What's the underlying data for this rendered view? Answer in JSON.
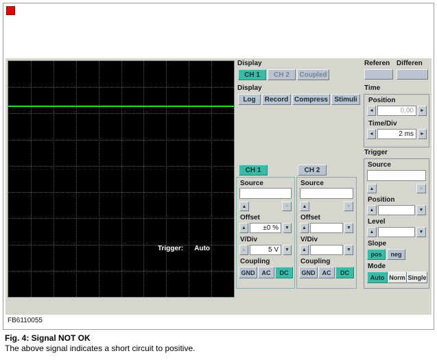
{
  "icons": {
    "up": "▲",
    "down": "▼",
    "left": "◄",
    "right": "►"
  },
  "scope": {
    "trigger_label": "Trigger:",
    "trigger_mode": "Auto",
    "grid": {
      "cols": 10,
      "rows": 9
    },
    "signal": {
      "color": "#1fe11f",
      "y_percent": 18.8
    }
  },
  "display_channels": {
    "label": "Display",
    "buttons": [
      "CH 1",
      "CH 2",
      "Coupled"
    ]
  },
  "display_modes": {
    "label": "Display",
    "buttons": [
      "Log",
      "Record",
      "Compress",
      "Stimuli"
    ]
  },
  "reference": {
    "label": "Referen"
  },
  "differential": {
    "label": "Differen"
  },
  "time": {
    "label": "Time",
    "position_label": "Position",
    "position_value": "0,00",
    "timediv_label": "Time/Div",
    "timediv_value": "2 ms"
  },
  "trigger": {
    "label": "Trigger",
    "source_label": "Source",
    "source_value": "",
    "position_label": "Position",
    "position_value": "",
    "level_label": "Level",
    "level_value": "",
    "slope_label": "Slope",
    "slope_pos": "pos",
    "slope_neg": "neg",
    "mode_label": "Mode",
    "mode_auto": "Auto",
    "mode_norm": "Norm",
    "mode_single": "Single"
  },
  "ch1": {
    "tab": "CH 1",
    "source_label": "Source",
    "source_value": "",
    "offset_label": "Offset",
    "offset_value": "±0 %",
    "vdiv_label": "V/Div",
    "vdiv_value": "5 V",
    "coupling_label": "Coupling",
    "gnd": "GND",
    "ac": "AC",
    "dc": "DC"
  },
  "ch2": {
    "tab": "CH 2",
    "source_label": "Source",
    "source_value": "",
    "offset_label": "Offset",
    "offset_value": "",
    "vdiv_label": "V/Div",
    "vdiv_value": "",
    "coupling_label": "Coupling",
    "gnd": "GND",
    "ac": "AC",
    "dc": "DC"
  },
  "figure": {
    "code": "FB6110055",
    "caption_title": "Fig. 4: Signal NOT OK",
    "caption_text": "The above signal indicates a short circuit to positive."
  }
}
